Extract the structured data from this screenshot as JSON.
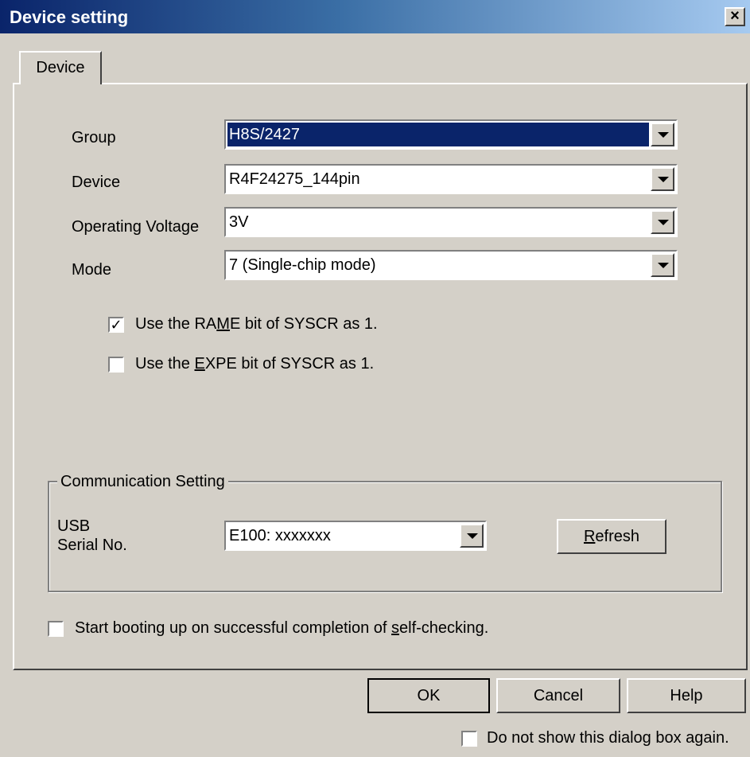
{
  "window": {
    "title": "Device setting",
    "close_label": "x"
  },
  "tabs": [
    {
      "label": "Device"
    }
  ],
  "fields": {
    "group": {
      "label": "Group",
      "value": "H8S/2427"
    },
    "device": {
      "label": "Device",
      "value": "R4F24275_144pin"
    },
    "voltage": {
      "label": "Operating Voltage",
      "value": "3V"
    },
    "mode": {
      "label": "Mode",
      "value": "7 (Single-chip mode)"
    }
  },
  "options": {
    "rame": {
      "pre": "Use the RA",
      "key": "M",
      "post": "E bit of SYSCR as 1.",
      "checked": true
    },
    "expe": {
      "pre": "Use the ",
      "key": "E",
      "post": "XPE bit of SYSCR as 1.",
      "checked": false
    }
  },
  "communication": {
    "title": "Communication Setting",
    "usb_label_1": "USB",
    "usb_label_2": "Serial No.",
    "serial_value": "E100:  xxxxxxx",
    "refresh_key": "R",
    "refresh_rest": "efresh"
  },
  "boot": {
    "pre": "Start booting up on successful completion of ",
    "key": "s",
    "post": "elf-checking.",
    "checked": false
  },
  "buttons": {
    "ok": "OK",
    "cancel": "Cancel",
    "help": "Help"
  },
  "footer": {
    "dont_show": "Do not show this dialog box again.",
    "checked": false
  }
}
